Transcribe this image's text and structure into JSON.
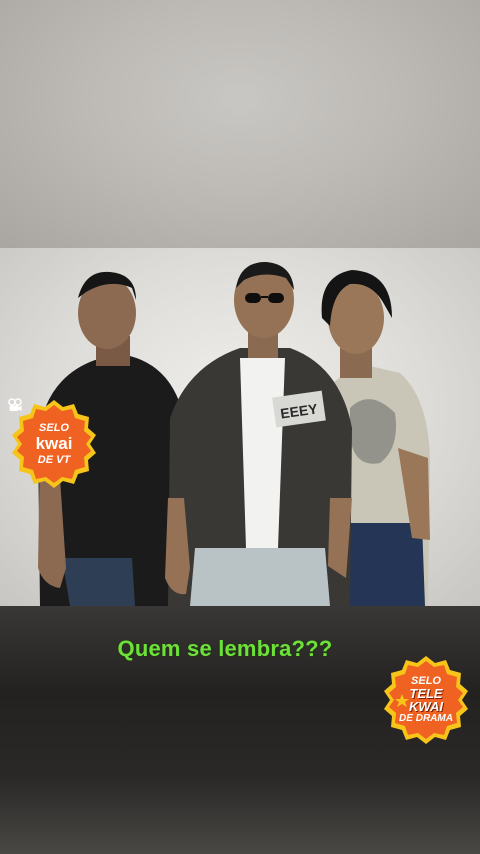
{
  "caption": "Quem se lembra???",
  "badge_left": {
    "line1": "SELO",
    "brand": "kwai",
    "line3": "DE VT"
  },
  "badge_right": {
    "line1": "SELO",
    "brand1": "TELE",
    "brand2": "KWAI",
    "line3": "DE DRAMA"
  },
  "photo": {
    "jacket_text": "EEEY"
  },
  "colors": {
    "caption": "#6ee03a",
    "badge_fill": "#f06222",
    "badge_ring": "#f7c41a"
  }
}
